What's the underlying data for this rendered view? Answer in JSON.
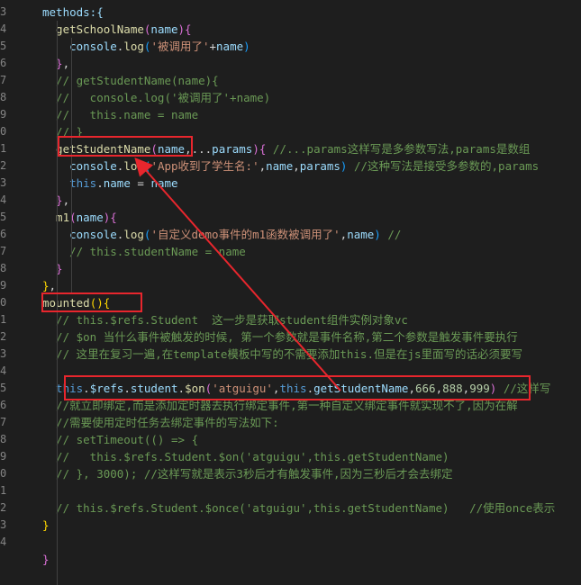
{
  "editor": {
    "line_numbers_partial": [
      "3",
      "4",
      "5",
      "6",
      "7",
      "8",
      "9",
      "0",
      "1",
      "2",
      "3",
      "4",
      "5",
      "6",
      "7",
      "8",
      "9",
      "0",
      "1",
      "2",
      "3",
      "4",
      "5",
      "6",
      "7",
      "8",
      "9",
      "0",
      "1",
      "2",
      "3",
      "4"
    ],
    "lines": [
      [
        {
          "t": "methods:{",
          "c": "t-key"
        }
      ],
      [
        {
          "t": "  getSchoolName",
          "c": "t-fn"
        },
        {
          "t": "(",
          "c": "t-p2"
        },
        {
          "t": "name",
          "c": "t-var"
        },
        {
          "t": "){",
          "c": "t-p2"
        }
      ],
      [
        {
          "t": "    console",
          "c": "t-var"
        },
        {
          "t": ".",
          "c": "t-plain"
        },
        {
          "t": "log",
          "c": "t-fn"
        },
        {
          "t": "(",
          "c": "t-p3"
        },
        {
          "t": "'被调用了'",
          "c": "t-str"
        },
        {
          "t": "+",
          "c": "t-plain"
        },
        {
          "t": "name",
          "c": "t-var"
        },
        {
          "t": ")",
          "c": "t-p3"
        }
      ],
      [
        {
          "t": "  }",
          "c": "t-p2"
        },
        {
          "t": ",",
          "c": "t-plain"
        }
      ],
      [
        {
          "t": "  // getStudentName(name){",
          "c": "t-cmt"
        }
      ],
      [
        {
          "t": "  //   console.log('被调用了'+name)",
          "c": "t-cmt"
        }
      ],
      [
        {
          "t": "  //   this.name = name",
          "c": "t-cmt"
        }
      ],
      [
        {
          "t": "  // }",
          "c": "t-cmt"
        }
      ],
      [
        {
          "t": "  getStudentName",
          "c": "t-fn"
        },
        {
          "t": "(",
          "c": "t-p2"
        },
        {
          "t": "name",
          "c": "t-var"
        },
        {
          "t": ",...",
          "c": "t-plain"
        },
        {
          "t": "params",
          "c": "t-var"
        },
        {
          "t": "){",
          "c": "t-p2"
        },
        {
          "t": " //...params这样写是多参数写法,params是数组",
          "c": "t-cmt"
        }
      ],
      [
        {
          "t": "    console",
          "c": "t-var"
        },
        {
          "t": ".",
          "c": "t-plain"
        },
        {
          "t": "log",
          "c": "t-fn"
        },
        {
          "t": "(",
          "c": "t-p3"
        },
        {
          "t": "'App收到了学生名:'",
          "c": "t-str"
        },
        {
          "t": ",",
          "c": "t-plain"
        },
        {
          "t": "name",
          "c": "t-var"
        },
        {
          "t": ",",
          "c": "t-plain"
        },
        {
          "t": "params",
          "c": "t-var"
        },
        {
          "t": ")",
          "c": "t-p3"
        },
        {
          "t": " //这种写法是接受多参数的,params",
          "c": "t-cmt"
        }
      ],
      [
        {
          "t": "    this",
          "c": "t-kw"
        },
        {
          "t": ".",
          "c": "t-plain"
        },
        {
          "t": "name",
          "c": "t-var"
        },
        {
          "t": " = ",
          "c": "t-plain"
        },
        {
          "t": "name",
          "c": "t-var"
        }
      ],
      [
        {
          "t": "  }",
          "c": "t-p2"
        },
        {
          "t": ",",
          "c": "t-plain"
        }
      ],
      [
        {
          "t": "  m1",
          "c": "t-fn"
        },
        {
          "t": "(",
          "c": "t-p2"
        },
        {
          "t": "name",
          "c": "t-var"
        },
        {
          "t": "){",
          "c": "t-p2"
        }
      ],
      [
        {
          "t": "    console",
          "c": "t-var"
        },
        {
          "t": ".",
          "c": "t-plain"
        },
        {
          "t": "log",
          "c": "t-fn"
        },
        {
          "t": "(",
          "c": "t-p3"
        },
        {
          "t": "'自定义demo事件的m1函数被调用了'",
          "c": "t-str"
        },
        {
          "t": ",",
          "c": "t-plain"
        },
        {
          "t": "name",
          "c": "t-var"
        },
        {
          "t": ")",
          "c": "t-p3"
        },
        {
          "t": " //",
          "c": "t-cmt"
        }
      ],
      [
        {
          "t": "    // this.studentName = name",
          "c": "t-cmt"
        }
      ],
      [
        {
          "t": "  }",
          "c": "t-p2"
        }
      ],
      [
        {
          "t": "}",
          "c": "t-p1"
        },
        {
          "t": ",",
          "c": "t-plain"
        }
      ],
      [
        {
          "t": "mounted",
          "c": "t-fn"
        },
        {
          "t": "()",
          "c": "t-p1"
        },
        {
          "t": "{",
          "c": "t-p1"
        }
      ],
      [
        {
          "t": "  // this.$refs.Student  这一步是获取student组件实例对象vc",
          "c": "t-cmt"
        }
      ],
      [
        {
          "t": "  // $on 当什么事件被触发的时候, 第一个参数就是事件名称,第二个参数是触发事件要执行",
          "c": "t-cmt"
        }
      ],
      [
        {
          "t": "  // 这里在复习一遍,在template模板中写的不需要添加this.但是在js里面写的话必须要写",
          "c": "t-cmt"
        }
      ],
      [
        {
          "t": "",
          "c": "t-plain"
        }
      ],
      [
        {
          "t": "  this",
          "c": "t-kw"
        },
        {
          "t": ".",
          "c": "t-plain"
        },
        {
          "t": "$refs",
          "c": "t-var"
        },
        {
          "t": ".",
          "c": "t-plain"
        },
        {
          "t": "student",
          "c": "t-var"
        },
        {
          "t": ".",
          "c": "t-plain"
        },
        {
          "t": "$on",
          "c": "t-fn"
        },
        {
          "t": "(",
          "c": "t-p2"
        },
        {
          "t": "'atguigu'",
          "c": "t-str"
        },
        {
          "t": ",",
          "c": "t-plain"
        },
        {
          "t": "this",
          "c": "t-kw"
        },
        {
          "t": ".",
          "c": "t-plain"
        },
        {
          "t": "getStudentName",
          "c": "t-var"
        },
        {
          "t": ",",
          "c": "t-plain"
        },
        {
          "t": "666",
          "c": "t-num"
        },
        {
          "t": ",",
          "c": "t-plain"
        },
        {
          "t": "888",
          "c": "t-num"
        },
        {
          "t": ",",
          "c": "t-plain"
        },
        {
          "t": "999",
          "c": "t-num"
        },
        {
          "t": ")",
          "c": "t-p2"
        },
        {
          "t": " //这样写",
          "c": "t-cmt"
        }
      ],
      [
        {
          "t": "  //就立即绑定,而是添加定时器去执行绑定事件,第一种自定义绑定事件就实现不了,因为在解",
          "c": "t-cmt"
        }
      ],
      [
        {
          "t": "  //需要使用定时任务去绑定事件的写法如下:",
          "c": "t-cmt"
        }
      ],
      [
        {
          "t": "  // setTimeout(() => {",
          "c": "t-cmt"
        }
      ],
      [
        {
          "t": "  //   this.$refs.Student.$on('atguigu',this.getStudentName)",
          "c": "t-cmt"
        }
      ],
      [
        {
          "t": "  // }, 3000); //这样写就是表示3秒后才有触发事件,因为三秒后才会去绑定",
          "c": "t-cmt"
        }
      ],
      [
        {
          "t": "",
          "c": "t-plain"
        }
      ],
      [
        {
          "t": "  // this.$refs.Student.$once('atguigu',this.getStudentName)   //使用once表示",
          "c": "t-cmt"
        }
      ],
      [
        {
          "t": "}",
          "c": "t-p1"
        }
      ],
      [
        {
          "t": "",
          "c": "t-plain"
        }
      ],
      [
        {
          "t": "}",
          "c": "t-p2"
        }
      ]
    ]
  },
  "colors": {
    "background": "#1e1e1e",
    "annotation": "#e8262d"
  }
}
